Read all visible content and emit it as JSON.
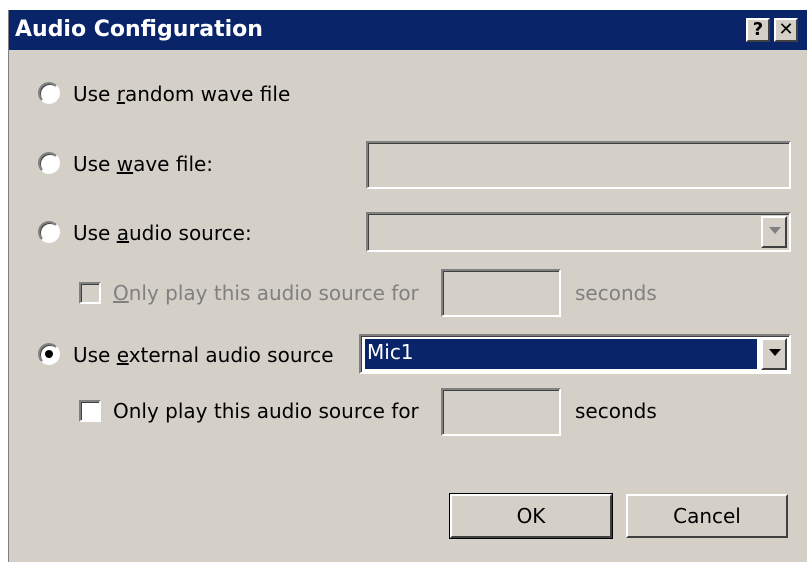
{
  "window": {
    "title": "Audio Configuration",
    "help_button": "?",
    "close_button": "✕"
  },
  "options": {
    "random_wave": {
      "label_pre": "Use ",
      "label_key": "r",
      "label_post": "andom wave file",
      "selected": false
    },
    "wave_file": {
      "label_pre": "Use ",
      "label_key": "w",
      "label_post": "ave file:",
      "value": "",
      "selected": false
    },
    "audio_source": {
      "label_pre": "Use ",
      "label_key": "a",
      "label_post": "udio source:",
      "value": "",
      "selected": false,
      "only_play": {
        "label_key": "O",
        "label_post": "nly play this audio source for",
        "checked": false,
        "enabled": false,
        "value": "",
        "units": "seconds"
      }
    },
    "external_source": {
      "label_pre": "Use ",
      "label_key": "e",
      "label_post": "xternal audio source",
      "value": "Mic1",
      "selected": true,
      "only_play": {
        "label": "Only play this audio source for",
        "checked": false,
        "enabled": true,
        "value": "",
        "units": "seconds"
      }
    }
  },
  "buttons": {
    "ok": "OK",
    "cancel": "Cancel"
  },
  "colors": {
    "titlebar": "#0a246a",
    "face": "#d4d0c8",
    "selection": "#0a246a"
  }
}
